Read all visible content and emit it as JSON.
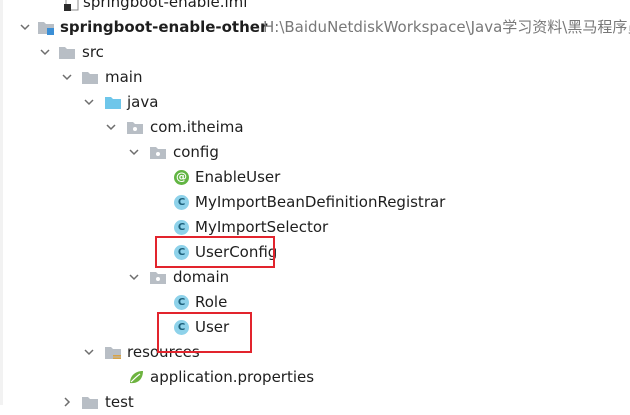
{
  "project_tree": {
    "items": [
      {
        "label": "springboot-enable.iml",
        "kind": "iml-file"
      },
      {
        "label": "springboot-enable-other",
        "path": "H:\\BaiduNetdiskWorkspace\\Java学习资料\\黑马程序员",
        "kind": "module",
        "expanded": true
      },
      {
        "label": "src",
        "kind": "folder",
        "expanded": true
      },
      {
        "label": "main",
        "kind": "folder",
        "expanded": true
      },
      {
        "label": "java",
        "kind": "source-folder",
        "expanded": true
      },
      {
        "label": "com.itheima",
        "kind": "package",
        "expanded": true
      },
      {
        "label": "config",
        "kind": "package",
        "expanded": true
      },
      {
        "label": "EnableUser",
        "kind": "annotation"
      },
      {
        "label": "MyImportBeanDefinitionRegistrar",
        "kind": "class"
      },
      {
        "label": "MyImportSelector",
        "kind": "class"
      },
      {
        "label": "UserConfig",
        "kind": "class",
        "highlighted": true
      },
      {
        "label": "domain",
        "kind": "package",
        "expanded": true
      },
      {
        "label": "Role",
        "kind": "class"
      },
      {
        "label": "User",
        "kind": "class",
        "highlighted": true
      },
      {
        "label": "resources",
        "kind": "resources-folder",
        "expanded": true
      },
      {
        "label": "application.properties",
        "kind": "properties-file"
      },
      {
        "label": "test",
        "kind": "folder",
        "expanded": false
      }
    ]
  },
  "icons": {
    "class_letter": "C",
    "annotation_letter": "@"
  },
  "colors": {
    "highlight": "#e2242d",
    "class_icon": "#8ed2ea",
    "annotation_icon": "#62b543",
    "folder": "#b8bec5",
    "source_folder": "#6ec6ea",
    "path_text": "#787878"
  }
}
